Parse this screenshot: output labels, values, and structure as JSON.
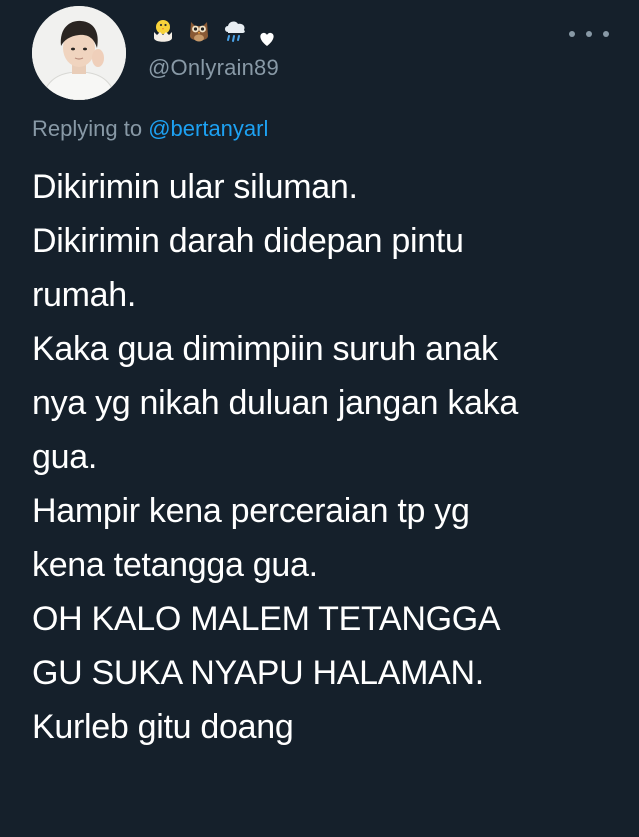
{
  "tweet": {
    "author": {
      "display_name_emojis": [
        "chick-hatching-icon",
        "owl-icon",
        "cloud-rain-icon",
        "white-heart-icon"
      ],
      "handle": "@Onlyrain89"
    },
    "reply": {
      "prefix": "Replying to",
      "mention": "@bertanyarl"
    },
    "body_lines": [
      "Dikirimin ular siluman.",
      "Dikirimin darah didepan pintu",
      "rumah.",
      "Kaka gua dimimpiin suruh anak",
      "nya yg nikah duluan jangan kaka",
      "gua.",
      "Hampir kena perceraian tp yg",
      "kena tetangga gua.",
      "OH KALO MALEM TETANGGA",
      "GU SUKA NYAPU HALAMAN.",
      "Kurleb gitu doang"
    ],
    "colors": {
      "background": "#15202b",
      "text": "#ffffff",
      "muted": "#8899a6",
      "link": "#1da1f2"
    }
  }
}
